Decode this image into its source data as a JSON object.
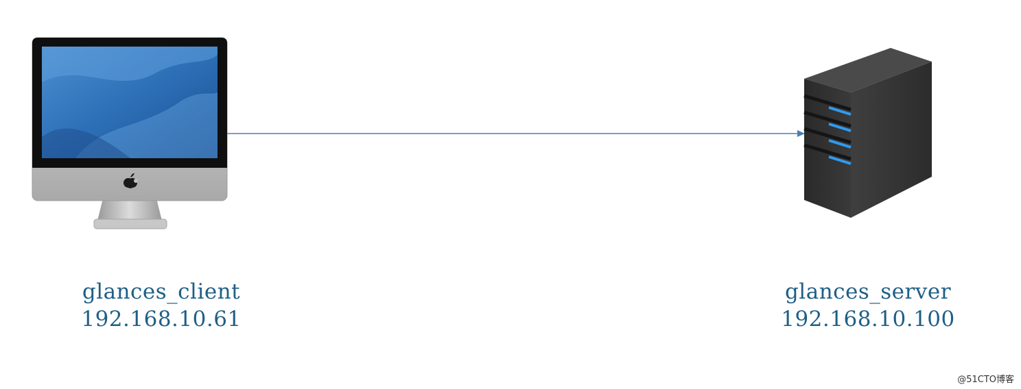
{
  "client": {
    "name": "glances_client",
    "ip": "192.168.10.61",
    "icon": "imac-icon"
  },
  "server": {
    "name": "glances_server",
    "ip": "192.168.10.100",
    "icon": "tower-server-icon"
  },
  "connection": {
    "direction": "client-to-server",
    "color": "#4a7fb0"
  },
  "colors": {
    "label": "#1f5f86",
    "server_led": "#2e9bf0"
  },
  "watermark": "@51CTO博客"
}
